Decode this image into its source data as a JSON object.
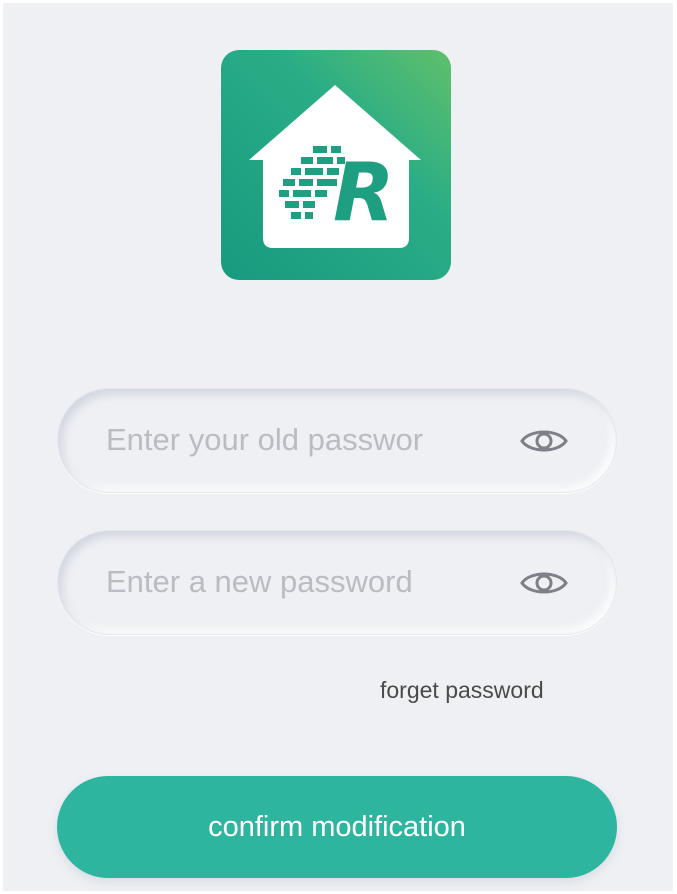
{
  "logo": {
    "letter": "R",
    "icon": "house-logo-icon",
    "gradient": [
      "#5fc06a",
      "#2aad86",
      "#179a7f"
    ]
  },
  "form": {
    "old_password": {
      "placeholder": "Enter your old passwor",
      "value": "",
      "icon": "eye-icon"
    },
    "new_password": {
      "placeholder": "Enter a new password",
      "value": "",
      "icon": "eye-icon"
    },
    "forget_link": "forget password",
    "confirm_label": "confirm modification"
  },
  "colors": {
    "background": "#eef0f4",
    "accent": "#2db59f",
    "placeholder": "#b9bcc2"
  }
}
